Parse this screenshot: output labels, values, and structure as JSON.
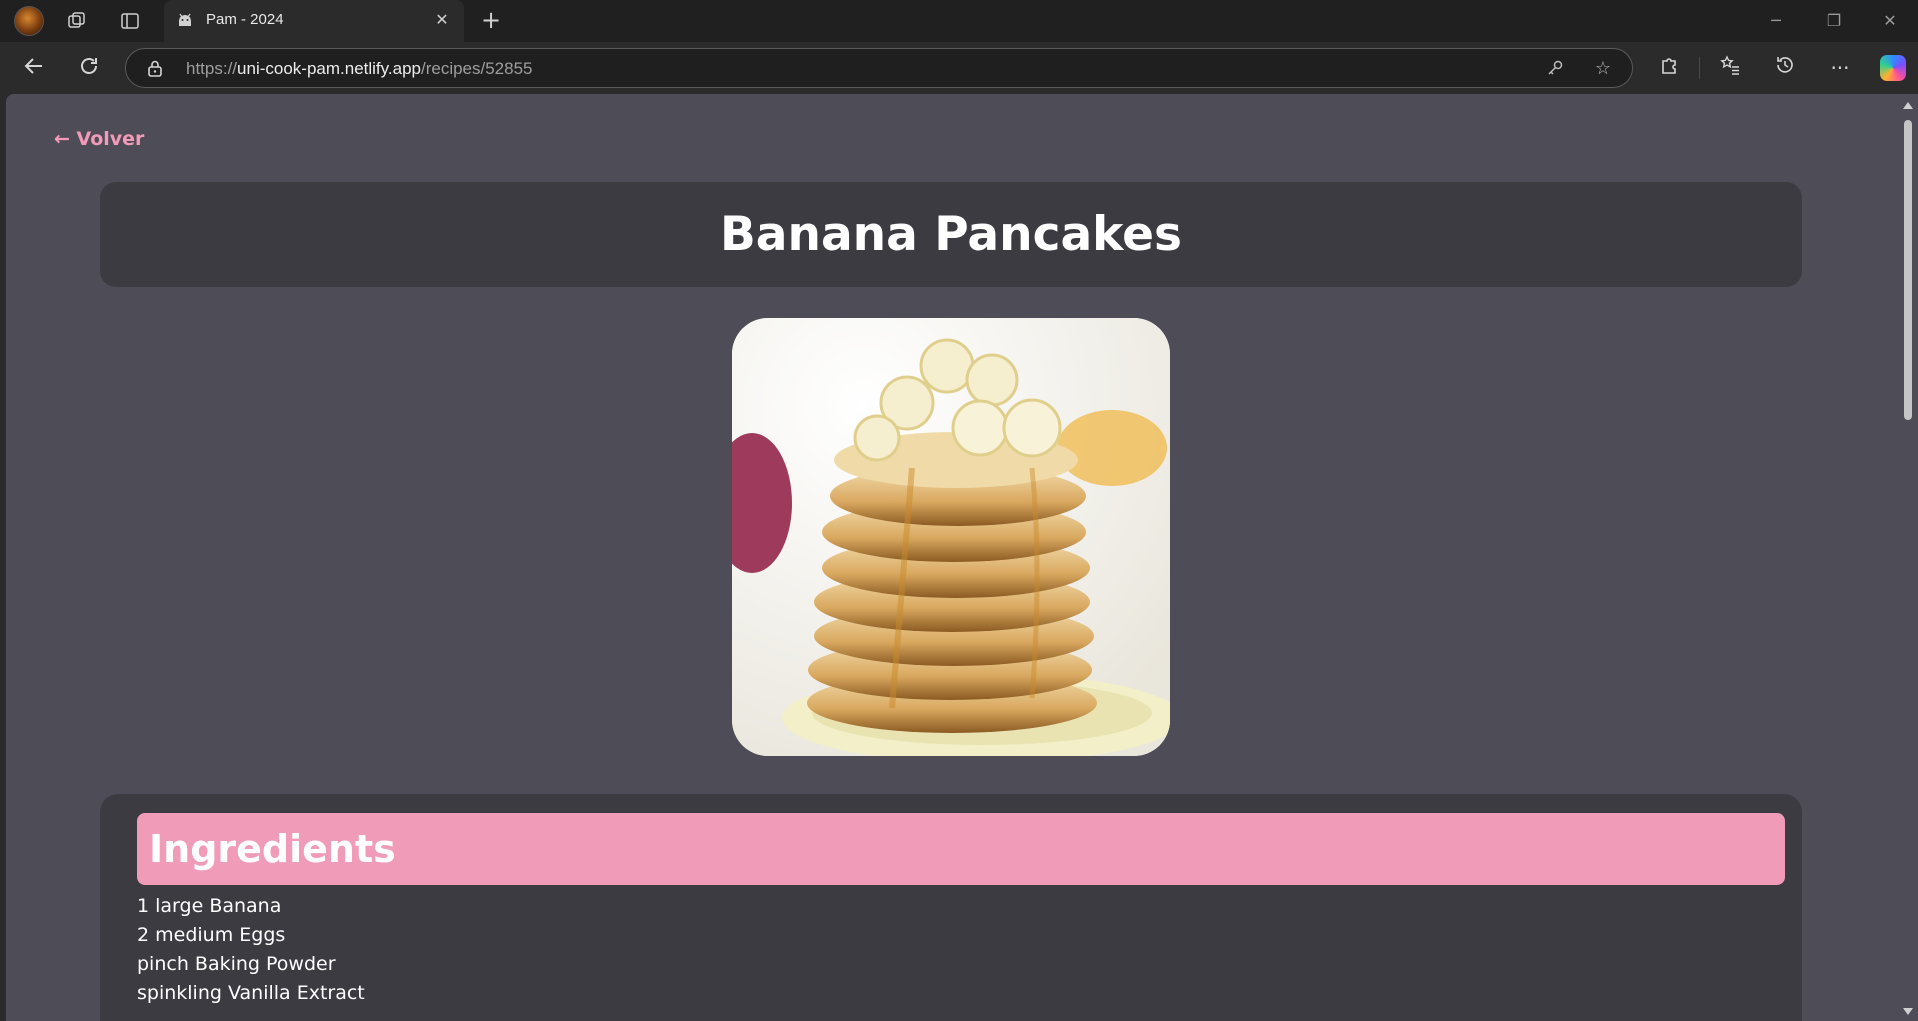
{
  "browser": {
    "tab": {
      "title": "Pam - 2024",
      "favicon": "android-icon"
    },
    "url": {
      "scheme": "https://",
      "host": "uni-cook-pam.netlify.app",
      "path": "/recipes/52855"
    }
  },
  "page": {
    "back_label": "← Volver",
    "recipe_title": "Banana Pancakes",
    "image_alt": "Banana Pancakes",
    "ingredients_heading": "Ingredients",
    "ingredients": [
      "1 large Banana",
      "2 medium Eggs",
      "pinch Baking Powder",
      "spinkling Vanilla Extract"
    ]
  },
  "colors": {
    "page_background": "#4e4c57",
    "card_background": "#3c3b42",
    "accent_pink": "#f09bb8",
    "link_pink": "#f29bb9"
  }
}
